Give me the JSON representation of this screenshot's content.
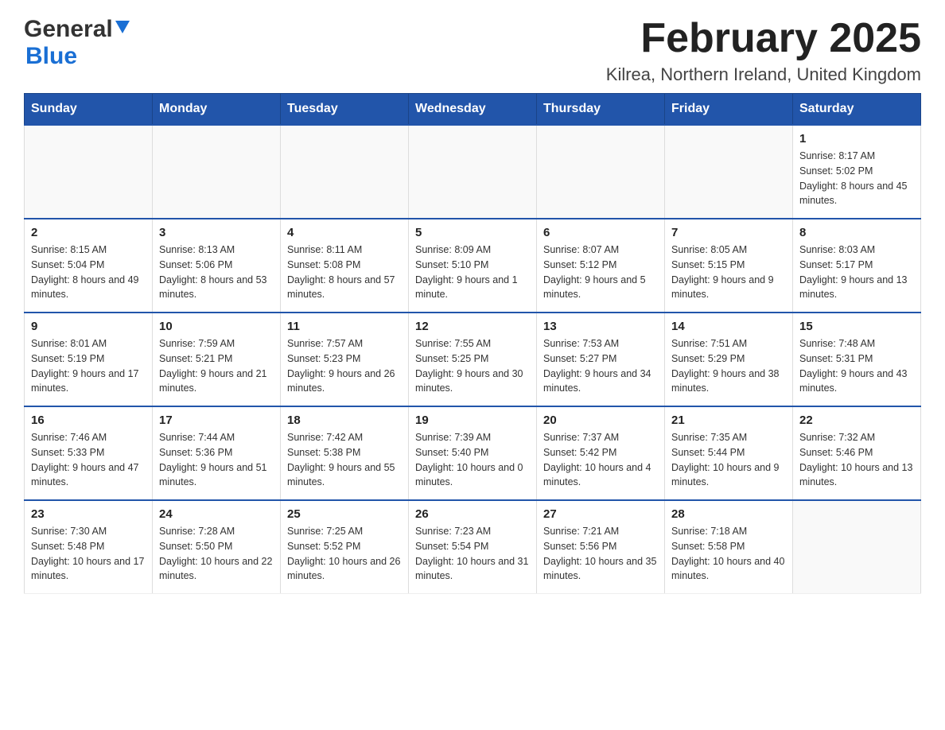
{
  "header": {
    "title": "February 2025",
    "subtitle": "Kilrea, Northern Ireland, United Kingdom",
    "logo_general": "General",
    "logo_blue": "Blue"
  },
  "weekdays": [
    "Sunday",
    "Monday",
    "Tuesday",
    "Wednesday",
    "Thursday",
    "Friday",
    "Saturday"
  ],
  "weeks": [
    [
      {
        "day": "",
        "sunrise": "",
        "sunset": "",
        "daylight": "",
        "empty": true
      },
      {
        "day": "",
        "sunrise": "",
        "sunset": "",
        "daylight": "",
        "empty": true
      },
      {
        "day": "",
        "sunrise": "",
        "sunset": "",
        "daylight": "",
        "empty": true
      },
      {
        "day": "",
        "sunrise": "",
        "sunset": "",
        "daylight": "",
        "empty": true
      },
      {
        "day": "",
        "sunrise": "",
        "sunset": "",
        "daylight": "",
        "empty": true
      },
      {
        "day": "",
        "sunrise": "",
        "sunset": "",
        "daylight": "",
        "empty": true
      },
      {
        "day": "1",
        "sunrise": "Sunrise: 8:17 AM",
        "sunset": "Sunset: 5:02 PM",
        "daylight": "Daylight: 8 hours and 45 minutes.",
        "empty": false
      }
    ],
    [
      {
        "day": "2",
        "sunrise": "Sunrise: 8:15 AM",
        "sunset": "Sunset: 5:04 PM",
        "daylight": "Daylight: 8 hours and 49 minutes.",
        "empty": false
      },
      {
        "day": "3",
        "sunrise": "Sunrise: 8:13 AM",
        "sunset": "Sunset: 5:06 PM",
        "daylight": "Daylight: 8 hours and 53 minutes.",
        "empty": false
      },
      {
        "day": "4",
        "sunrise": "Sunrise: 8:11 AM",
        "sunset": "Sunset: 5:08 PM",
        "daylight": "Daylight: 8 hours and 57 minutes.",
        "empty": false
      },
      {
        "day": "5",
        "sunrise": "Sunrise: 8:09 AM",
        "sunset": "Sunset: 5:10 PM",
        "daylight": "Daylight: 9 hours and 1 minute.",
        "empty": false
      },
      {
        "day": "6",
        "sunrise": "Sunrise: 8:07 AM",
        "sunset": "Sunset: 5:12 PM",
        "daylight": "Daylight: 9 hours and 5 minutes.",
        "empty": false
      },
      {
        "day": "7",
        "sunrise": "Sunrise: 8:05 AM",
        "sunset": "Sunset: 5:15 PM",
        "daylight": "Daylight: 9 hours and 9 minutes.",
        "empty": false
      },
      {
        "day": "8",
        "sunrise": "Sunrise: 8:03 AM",
        "sunset": "Sunset: 5:17 PM",
        "daylight": "Daylight: 9 hours and 13 minutes.",
        "empty": false
      }
    ],
    [
      {
        "day": "9",
        "sunrise": "Sunrise: 8:01 AM",
        "sunset": "Sunset: 5:19 PM",
        "daylight": "Daylight: 9 hours and 17 minutes.",
        "empty": false
      },
      {
        "day": "10",
        "sunrise": "Sunrise: 7:59 AM",
        "sunset": "Sunset: 5:21 PM",
        "daylight": "Daylight: 9 hours and 21 minutes.",
        "empty": false
      },
      {
        "day": "11",
        "sunrise": "Sunrise: 7:57 AM",
        "sunset": "Sunset: 5:23 PM",
        "daylight": "Daylight: 9 hours and 26 minutes.",
        "empty": false
      },
      {
        "day": "12",
        "sunrise": "Sunrise: 7:55 AM",
        "sunset": "Sunset: 5:25 PM",
        "daylight": "Daylight: 9 hours and 30 minutes.",
        "empty": false
      },
      {
        "day": "13",
        "sunrise": "Sunrise: 7:53 AM",
        "sunset": "Sunset: 5:27 PM",
        "daylight": "Daylight: 9 hours and 34 minutes.",
        "empty": false
      },
      {
        "day": "14",
        "sunrise": "Sunrise: 7:51 AM",
        "sunset": "Sunset: 5:29 PM",
        "daylight": "Daylight: 9 hours and 38 minutes.",
        "empty": false
      },
      {
        "day": "15",
        "sunrise": "Sunrise: 7:48 AM",
        "sunset": "Sunset: 5:31 PM",
        "daylight": "Daylight: 9 hours and 43 minutes.",
        "empty": false
      }
    ],
    [
      {
        "day": "16",
        "sunrise": "Sunrise: 7:46 AM",
        "sunset": "Sunset: 5:33 PM",
        "daylight": "Daylight: 9 hours and 47 minutes.",
        "empty": false
      },
      {
        "day": "17",
        "sunrise": "Sunrise: 7:44 AM",
        "sunset": "Sunset: 5:36 PM",
        "daylight": "Daylight: 9 hours and 51 minutes.",
        "empty": false
      },
      {
        "day": "18",
        "sunrise": "Sunrise: 7:42 AM",
        "sunset": "Sunset: 5:38 PM",
        "daylight": "Daylight: 9 hours and 55 minutes.",
        "empty": false
      },
      {
        "day": "19",
        "sunrise": "Sunrise: 7:39 AM",
        "sunset": "Sunset: 5:40 PM",
        "daylight": "Daylight: 10 hours and 0 minutes.",
        "empty": false
      },
      {
        "day": "20",
        "sunrise": "Sunrise: 7:37 AM",
        "sunset": "Sunset: 5:42 PM",
        "daylight": "Daylight: 10 hours and 4 minutes.",
        "empty": false
      },
      {
        "day": "21",
        "sunrise": "Sunrise: 7:35 AM",
        "sunset": "Sunset: 5:44 PM",
        "daylight": "Daylight: 10 hours and 9 minutes.",
        "empty": false
      },
      {
        "day": "22",
        "sunrise": "Sunrise: 7:32 AM",
        "sunset": "Sunset: 5:46 PM",
        "daylight": "Daylight: 10 hours and 13 minutes.",
        "empty": false
      }
    ],
    [
      {
        "day": "23",
        "sunrise": "Sunrise: 7:30 AM",
        "sunset": "Sunset: 5:48 PM",
        "daylight": "Daylight: 10 hours and 17 minutes.",
        "empty": false
      },
      {
        "day": "24",
        "sunrise": "Sunrise: 7:28 AM",
        "sunset": "Sunset: 5:50 PM",
        "daylight": "Daylight: 10 hours and 22 minutes.",
        "empty": false
      },
      {
        "day": "25",
        "sunrise": "Sunrise: 7:25 AM",
        "sunset": "Sunset: 5:52 PM",
        "daylight": "Daylight: 10 hours and 26 minutes.",
        "empty": false
      },
      {
        "day": "26",
        "sunrise": "Sunrise: 7:23 AM",
        "sunset": "Sunset: 5:54 PM",
        "daylight": "Daylight: 10 hours and 31 minutes.",
        "empty": false
      },
      {
        "day": "27",
        "sunrise": "Sunrise: 7:21 AM",
        "sunset": "Sunset: 5:56 PM",
        "daylight": "Daylight: 10 hours and 35 minutes.",
        "empty": false
      },
      {
        "day": "28",
        "sunrise": "Sunrise: 7:18 AM",
        "sunset": "Sunset: 5:58 PM",
        "daylight": "Daylight: 10 hours and 40 minutes.",
        "empty": false
      },
      {
        "day": "",
        "sunrise": "",
        "sunset": "",
        "daylight": "",
        "empty": true
      }
    ]
  ]
}
